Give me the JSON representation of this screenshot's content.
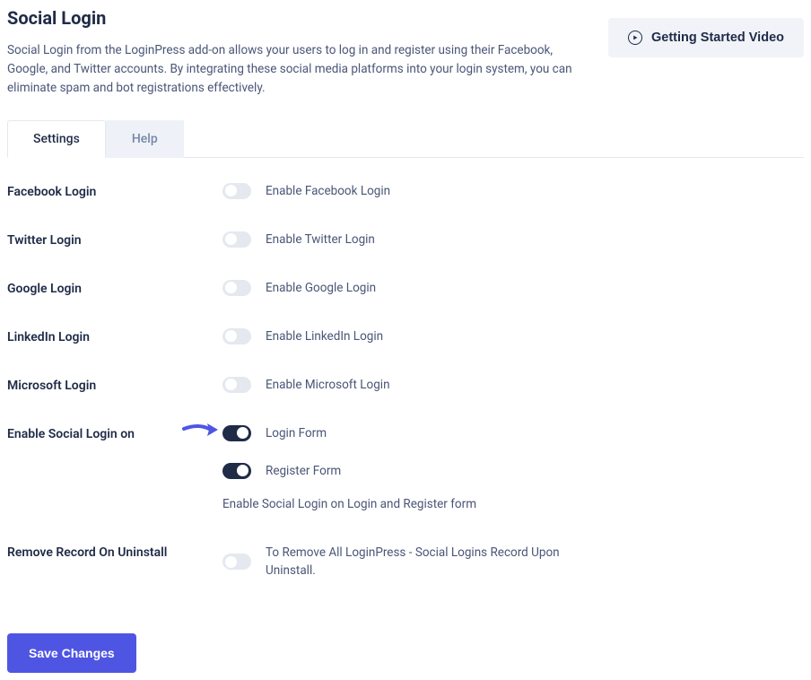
{
  "header": {
    "title": "Social Login",
    "description": "Social Login from the LoginPress add-on allows your users to log in and register using their Facebook, Google, and Twitter accounts. By integrating these social media platforms into your login system, you can eliminate spam and bot registrations effectively.",
    "video_button": "Getting Started Video"
  },
  "tabs": {
    "settings": "Settings",
    "help": "Help"
  },
  "settings": {
    "facebook": {
      "label": "Facebook Login",
      "desc": "Enable Facebook Login"
    },
    "twitter": {
      "label": "Twitter Login",
      "desc": "Enable Twitter Login"
    },
    "google": {
      "label": "Google Login",
      "desc": "Enable Google Login"
    },
    "linkedin": {
      "label": "LinkedIn Login",
      "desc": "Enable LinkedIn Login"
    },
    "microsoft": {
      "label": "Microsoft Login",
      "desc": "Enable Microsoft Login"
    },
    "enable_on": {
      "label": "Enable Social Login on",
      "login_form": "Login Form",
      "register_form": "Register Form",
      "help": "Enable Social Login on Login and Register form"
    },
    "remove_record": {
      "label": "Remove Record On Uninstall",
      "desc": "To Remove All LoginPress - Social Logins Record Upon Uninstall."
    }
  },
  "save_button": "Save Changes"
}
